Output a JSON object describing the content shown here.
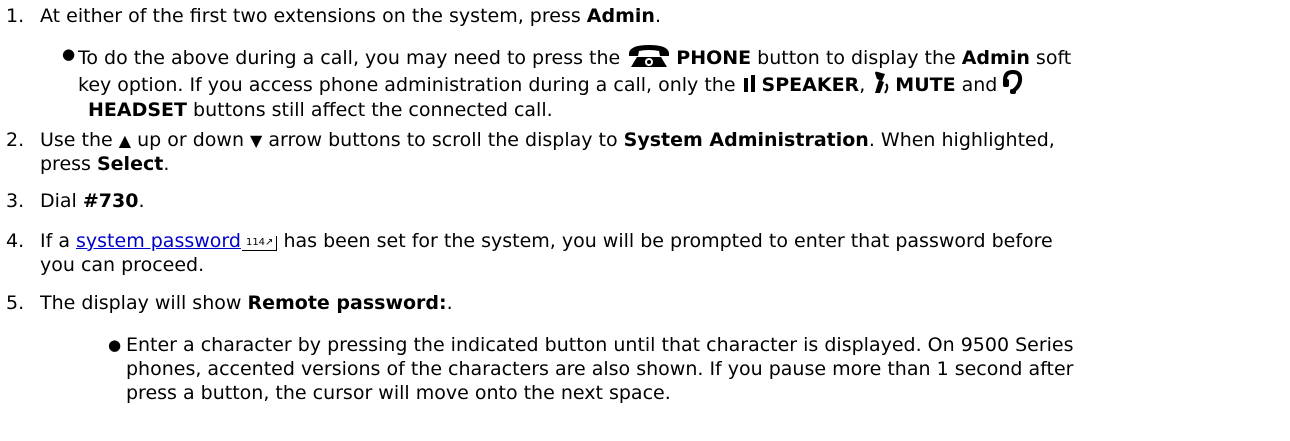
{
  "steps": [
    {
      "number": "1.",
      "segments": [
        "At either of the first two extensions on the system, press ",
        "Admin",
        "."
      ],
      "bullet": {
        "l1_a": "To do the above during a call, you may need to press the ",
        "phone": "PHONE",
        "l1_b": " button to display the ",
        "admin": "Admin",
        "l1_c": " soft",
        "l2_a": "key option. If you access phone administration during a call, only the ",
        "speaker": "SPEAKER",
        "l2_b": ", ",
        "mute": "MUTE",
        "l2_c": " and",
        "headset": "HEADSET",
        "l3_a": " buttons still affect the connected call."
      }
    },
    {
      "number": "2.",
      "l1_a": "Use the ",
      "l1_b": " up or down ",
      "l1_c": " arrow buttons to scroll the display to ",
      "l1_bold": "System Administration",
      "l1_d": ". When highlighted,",
      "l2_a": "press ",
      "l2_bold": "Select",
      "l2_b": "."
    },
    {
      "number": "3.",
      "a": "Dial ",
      "bold": "#730",
      "b": "."
    },
    {
      "number": "4.",
      "a": "If a ",
      "link": "system password",
      "pageref": "114",
      "b": " has been set for the system, you will be prompted to enter that password before",
      "l2": "you can proceed."
    },
    {
      "number": "5.",
      "a": "The display will show ",
      "bold": "Remote password:",
      "b": ".",
      "bullet_lines": [
        "Enter a character by pressing the indicated button until that character is displayed. On 9500 Series",
        "phones, accented versions of the characters are also shown. If you pause more than 1 second after",
        "press a button, the cursor will move onto the next space."
      ]
    }
  ],
  "icons": {
    "phone": "phone-handset-icon",
    "speaker": "speaker-icon",
    "mute": "microphone-mute-icon",
    "headset": "headset-icon",
    "up": "up-arrow-icon",
    "down": "down-arrow-icon",
    "pageref": "page-reference-icon"
  },
  "colors": {
    "text": "#000000",
    "link": "#0000cc"
  }
}
